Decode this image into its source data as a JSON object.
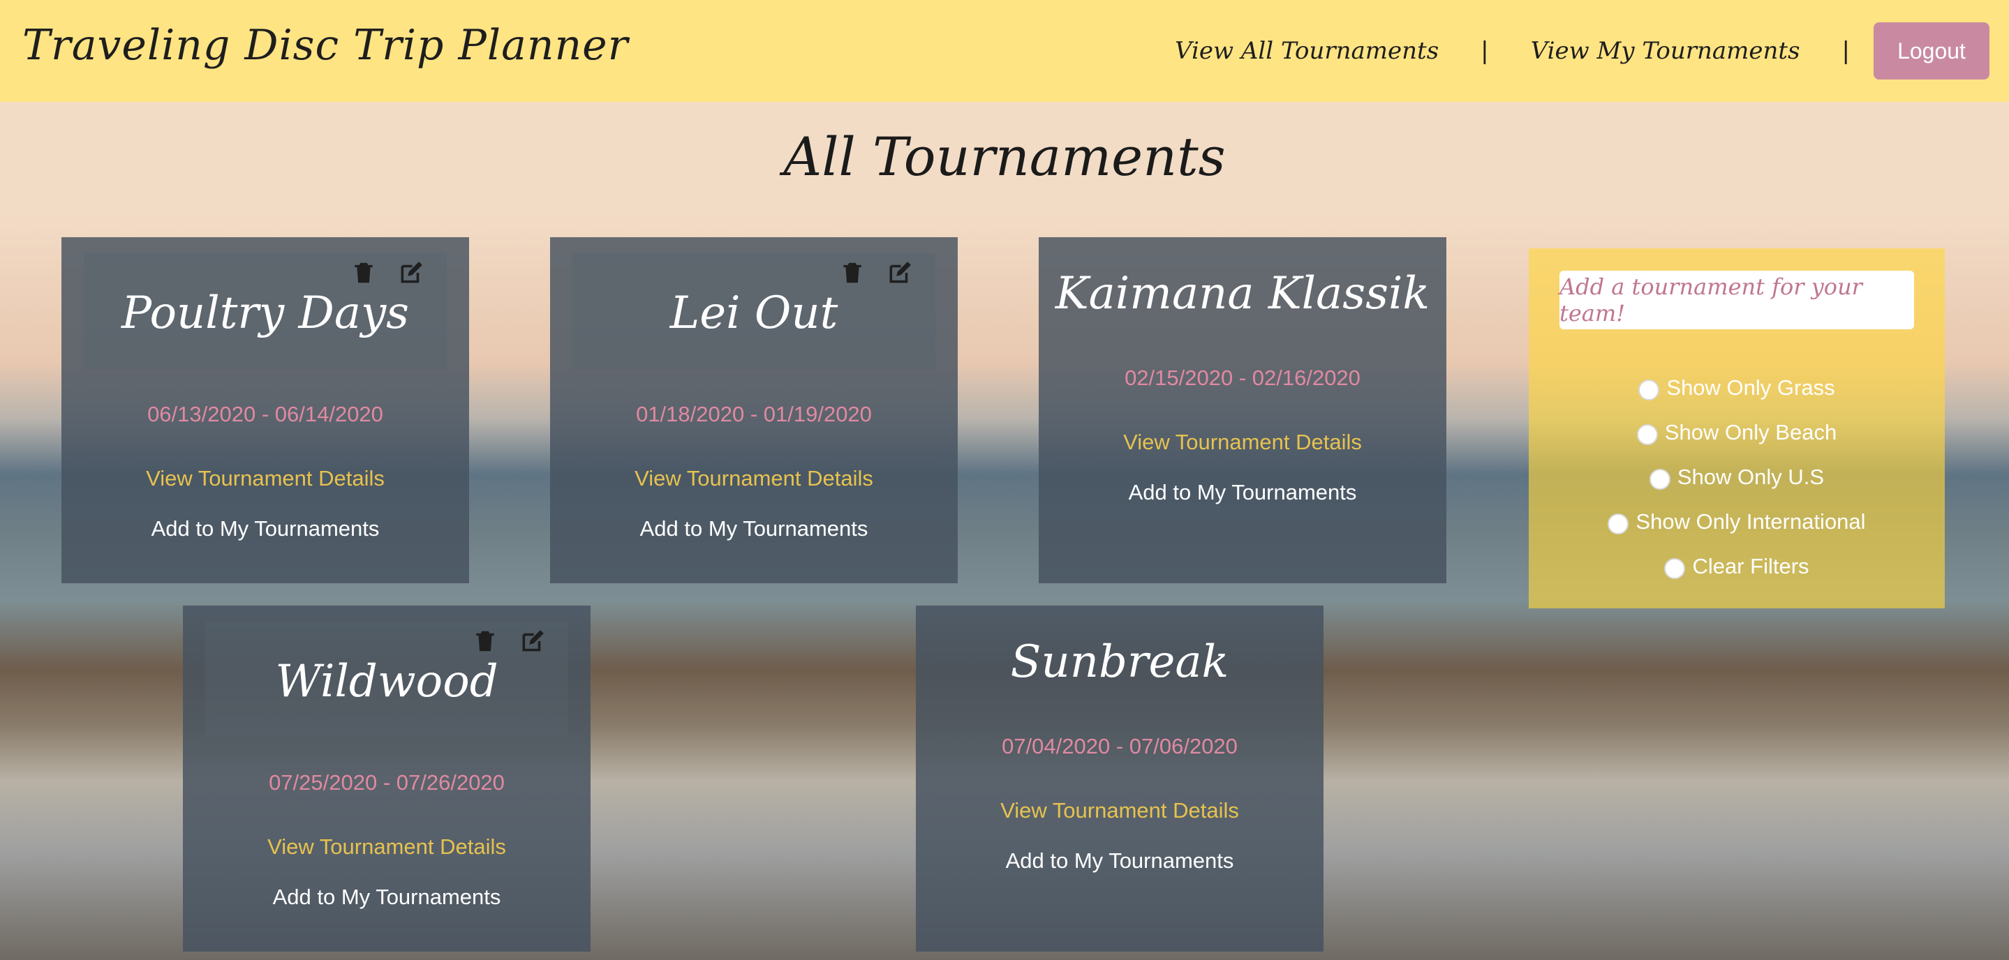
{
  "header": {
    "brand": "Traveling Disc Trip Planner",
    "nav": {
      "all_tournaments": "View All Tournaments",
      "separator": "|",
      "my_tournaments": "View My Tournaments",
      "logout": "Logout"
    }
  },
  "page_title": "All Tournaments",
  "cards": [
    {
      "title": "Poultry Days",
      "dates": "06/13/2020 - 06/14/2020",
      "details": "View Tournament Details",
      "add": "Add to My Tournaments"
    },
    {
      "title": "Lei Out",
      "dates": "01/18/2020 - 01/19/2020",
      "details": "View Tournament Details",
      "add": "Add to My Tournaments"
    },
    {
      "title": "Kaimana Klassik",
      "dates": "02/15/2020 - 02/16/2020",
      "details": "View Tournament Details",
      "add": "Add to My Tournaments"
    },
    {
      "title": "Wildwood",
      "dates": "07/25/2020 - 07/26/2020",
      "details": "View Tournament Details",
      "add": "Add to My Tournaments"
    },
    {
      "title": "Sunbreak",
      "dates": "07/04/2020 - 07/06/2020",
      "details": "View Tournament Details",
      "add": "Add to My Tournaments"
    }
  ],
  "filters": {
    "add_tournament": "Add a tournament for your team!",
    "options": [
      "Show Only Grass",
      "Show Only Beach",
      "Show Only U.S",
      "Show Only International",
      "Clear Filters"
    ]
  },
  "colors": {
    "header_bg": "#ffe483",
    "logout_bg": "#c98aa1",
    "date_text": "#e08aa1",
    "details_text": "#e7c24f"
  },
  "icons": [
    "trash-icon",
    "edit-icon"
  ]
}
